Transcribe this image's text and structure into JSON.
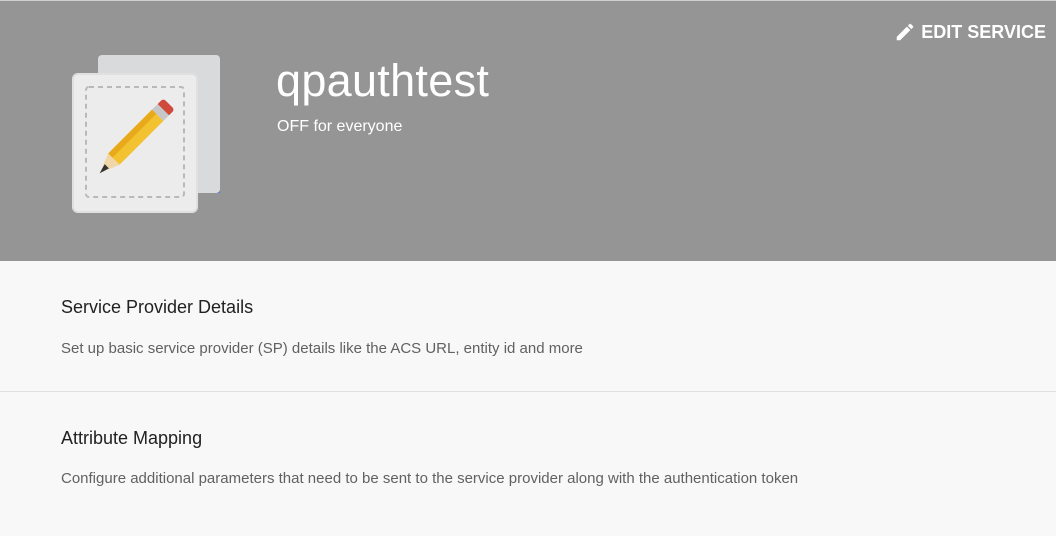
{
  "header": {
    "title": "qpauthtest",
    "status": "OFF for everyone",
    "edit_label": "EDIT SERVICE",
    "background_color": "#959595",
    "app_icon": "pencil-document-icon",
    "edit_icon": "pencil-icon"
  },
  "sections": [
    {
      "title": "Service Provider Details",
      "description": "Set up basic service provider (SP) details like the ACS URL, entity id and more"
    },
    {
      "title": "Attribute Mapping",
      "description": "Configure additional parameters that need to be sent to the service provider along with the authentication token"
    }
  ]
}
